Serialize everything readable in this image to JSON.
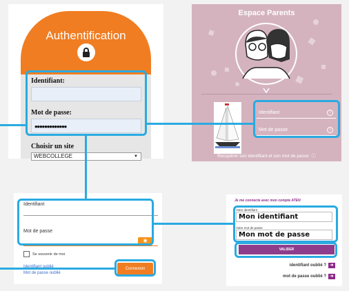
{
  "panel_auth": {
    "title": "Authentification",
    "login_label": "Identifiant:",
    "password_label": "Mot de passe:",
    "password_value": "•••••••••••••",
    "site_label": "Choisir un site",
    "site_selected": "WEBCOLLEGE"
  },
  "panel_parents": {
    "title": "Espace Parents",
    "login_placeholder": "Identifiant",
    "password_placeholder": "Mot de passe",
    "recover_text": "Recupérer son identifiant et son mot de passe"
  },
  "panel_form": {
    "login_label": "Identifiant",
    "password_label": "Mot de passe",
    "remember_label": "Se souvenir de moi",
    "forgot_login": "Identifiant oublié",
    "forgot_password": "Mot de passe oublié",
    "connect_button": "Connexion"
  },
  "panel_aten": {
    "header": "Je me connecte avec mon compte ATEN",
    "login_small": "Votre identifiant",
    "login_value": "Mon identifiant",
    "password_small": "Votre mot de passe",
    "password_value": "Mon mot de passe",
    "validate_button": "VALIDER",
    "forgot_login": "identifiant oublié ?",
    "forgot_password": "mot de passe oublié ?"
  },
  "colors": {
    "accent_blue": "#29aae1",
    "orange": "#f07d22",
    "parents_pink": "#d4b3bf",
    "aten_purple": "#8e2a8a"
  }
}
